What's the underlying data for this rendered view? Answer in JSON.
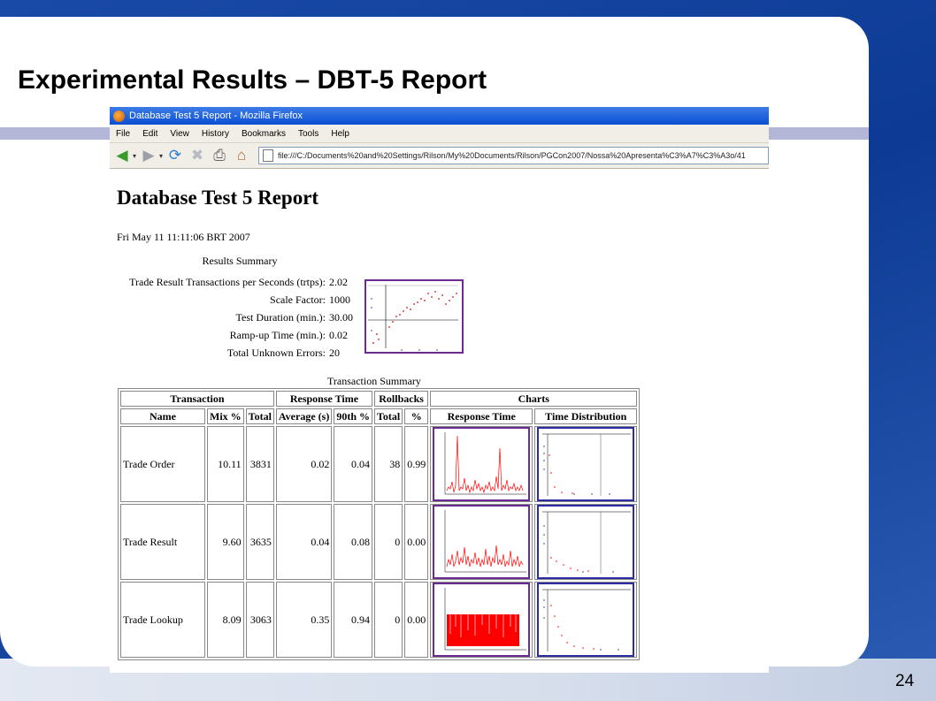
{
  "slide": {
    "title": "Experimental Results – DBT-5 Report",
    "page_number": "24"
  },
  "browser": {
    "window_title": "Database Test 5 Report - Mozilla Firefox",
    "menu": [
      "File",
      "Edit",
      "View",
      "History",
      "Bookmarks",
      "Tools",
      "Help"
    ],
    "url": "file:///C:/Documents%20and%20Settings/Rilson/My%20Documents/Rilson/PGCon2007/Nossa%20Apresenta%C3%A7%C3%A3o/41"
  },
  "report": {
    "title": "Database Test 5 Report",
    "date": "Fri May 11 11:11:06 BRT 2007",
    "summary_caption": "Results Summary",
    "summary": [
      {
        "label": "Trade Result Transactions per Seconds (trtps):",
        "value": "2.02"
      },
      {
        "label": "Scale Factor:",
        "value": "1000"
      },
      {
        "label": "Test Duration (min.):",
        "value": "30.00"
      },
      {
        "label": "Ramp-up Time (min.):",
        "value": "0.02"
      },
      {
        "label": "Total Unknown Errors:",
        "value": "20"
      }
    ],
    "table_caption": "Transaction Summary",
    "groups": [
      "Transaction",
      "Response Time",
      "Rollbacks",
      "Charts"
    ],
    "columns": [
      "Name",
      "Mix %",
      "Total",
      "Average (s)",
      "90th %",
      "Total",
      "%",
      "Response Time",
      "Time Distribution"
    ],
    "rows": [
      {
        "name": "Trade Order",
        "mix": "10.11",
        "total": "3831",
        "avg": "0.02",
        "p90": "0.04",
        "rb_total": "38",
        "rb_pct": "0.99"
      },
      {
        "name": "Trade Result",
        "mix": "9.60",
        "total": "3635",
        "avg": "0.04",
        "p90": "0.08",
        "rb_total": "0",
        "rb_pct": "0.00"
      },
      {
        "name": "Trade Lookup",
        "mix": "8.09",
        "total": "3063",
        "avg": "0.35",
        "p90": "0.94",
        "rb_total": "0",
        "rb_pct": "0.00"
      }
    ]
  },
  "colors": {
    "accent": "#0c3a94",
    "chart_red": "#ff0000",
    "resp_border": "#6b2a8e",
    "dist_border": "#2b2ba6"
  }
}
